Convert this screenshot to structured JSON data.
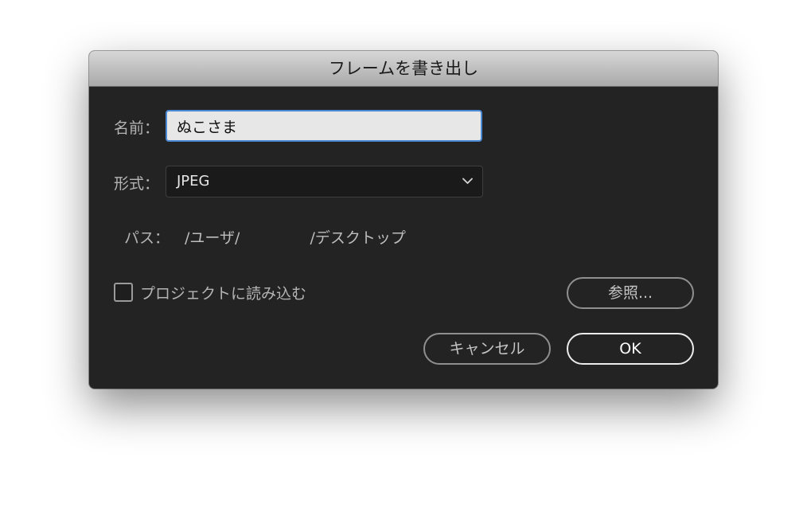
{
  "dialog": {
    "title": "フレームを書き出し"
  },
  "form": {
    "name_label": "名前：",
    "name_value": "ぬこさま",
    "format_label": "形式：",
    "format_value": "JPEG",
    "path_label": "パス：",
    "path_value_prefix": "/ユーザ/",
    "path_value_suffix": "/デスクトップ"
  },
  "options": {
    "import_checkbox_label": "プロジェクトに読み込む",
    "import_checked": false
  },
  "buttons": {
    "browse": "参照...",
    "cancel": "キャンセル",
    "ok": "OK"
  },
  "icons": {
    "select_arrow": "chevron-down-icon"
  },
  "colors": {
    "focus_ring": "#4a8ad4",
    "dialog_background": "#232323"
  }
}
